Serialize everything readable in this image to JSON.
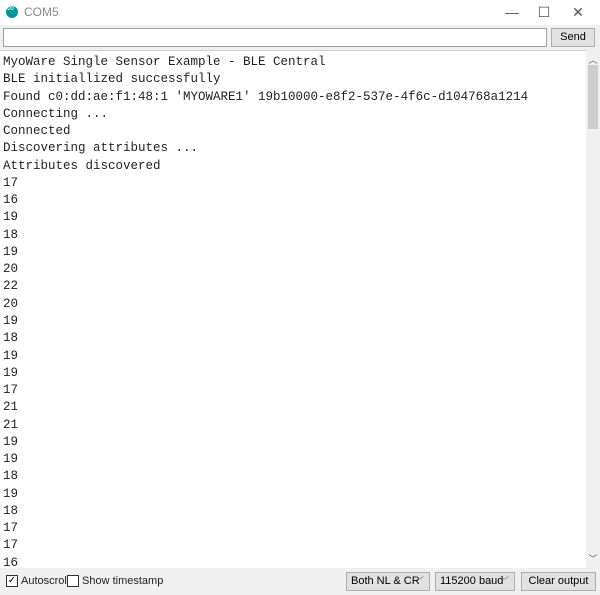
{
  "window": {
    "title": "COM5",
    "minimize": "—",
    "maximize": "☐",
    "close": "✕"
  },
  "input": {
    "value": "",
    "send_label": "Send"
  },
  "output": {
    "lines": [
      "MyoWare Single Sensor Example - BLE Central",
      "BLE initiallized successfully",
      "Found c0:dd:ae:f1:48:1 'MYOWARE1' 19b10000-e8f2-537e-4f6c-d104768a1214",
      "Connecting ...",
      "Connected",
      "Discovering attributes ...",
      "Attributes discovered",
      "17",
      "16",
      "19",
      "18",
      "19",
      "20",
      "22",
      "20",
      "19",
      "18",
      "19",
      "19",
      "17",
      "21",
      "21",
      "19",
      "19",
      "18",
      "19",
      "18",
      "17",
      "17",
      "16"
    ]
  },
  "bottom": {
    "autoscroll_label": "Autoscroll",
    "autoscroll_checked": true,
    "timestamp_label": "Show timestamp",
    "timestamp_checked": false,
    "line_ending": "Both NL & CR",
    "baud": "115200 baud",
    "clear_label": "Clear output"
  },
  "colors": {
    "accent": "#00979c"
  }
}
